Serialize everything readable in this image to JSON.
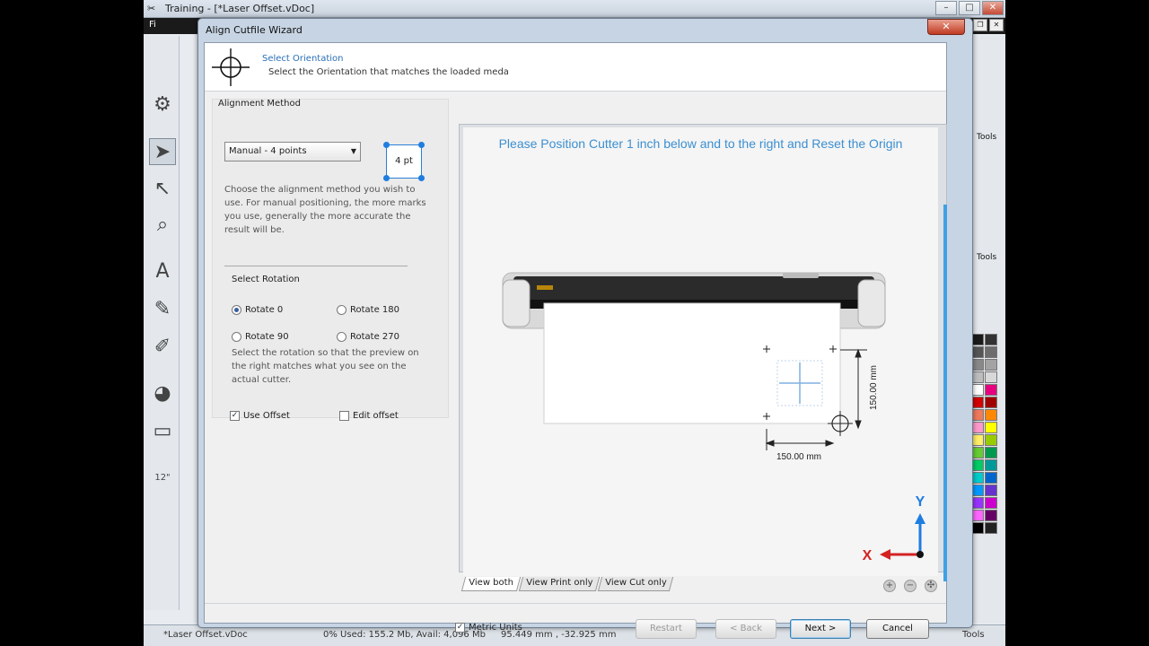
{
  "app": {
    "title": "Training - [*Laser Offset.vDoc]",
    "menu_first": "Fi",
    "right_panel": {
      "tools_label": "Tools",
      "tools_label2": "Tools"
    },
    "status": {
      "doc": "*Laser Offset.vDoc",
      "memory": "0%  Used: 155.2 Mb, Avail: 4,096 Mb",
      "coords": "95.449 mm , -32.925 mm",
      "tools": "Tools"
    }
  },
  "dialog": {
    "title": "Align Cutfile Wizard",
    "close_glyph": "✕",
    "header": {
      "title": "Select Orientation",
      "subtitle": "Select the Orientation that matches the loaded meda"
    },
    "alignment": {
      "label": "Alignment Method",
      "selected": "Manual - 4 points",
      "point_badge": "4 pt",
      "description": "Choose the alignment method you wish to use. For manual positioning, the more marks you use, generally the more accurate the result will be."
    },
    "rotation": {
      "label": "Select Rotation",
      "options": [
        "Rotate 0",
        "Rotate 180",
        "Rotate 90",
        "Rotate 270"
      ],
      "selected": "Rotate 0",
      "description": "Select the rotation so that the preview on the right matches what you see on the actual cutter."
    },
    "use_offset": {
      "label": "Use Offset",
      "checked": true
    },
    "edit_offset": {
      "label": "Edit offset",
      "checked": false
    },
    "preview": {
      "instruction": "Please Position Cutter 1 inch below and to the right and Reset the Origin",
      "dim_vertical": "150.00 mm",
      "dim_horizontal": "150.00 mm",
      "axis_y": "Y",
      "axis_x": "X"
    },
    "view_tabs": [
      "View both",
      "View Print only",
      "View Cut only"
    ],
    "active_tab": "View both",
    "zoom_icons": [
      "zoom-in-icon",
      "zoom-out-icon",
      "zoom-fit-icon"
    ],
    "metric_units": {
      "label": "Metric Units",
      "checked": true
    },
    "buttons": {
      "restart": "Restart",
      "back": "< Back",
      "next": "Next >",
      "cancel": "Cancel"
    }
  },
  "colors": {
    "accent": "#2a6fb6",
    "instruction": "#3b8fd0",
    "axis_y": "#1e7de0",
    "axis_x": "#d32222",
    "palette": [
      "#1a1a1a",
      "#333333",
      "#555555",
      "#6d6d6d",
      "#888888",
      "#a3a3a3",
      "#bdbdbd",
      "#d8d8d8",
      "#ffffff",
      "#e6007e",
      "#d40000",
      "#a00000",
      "#f07a5a",
      "#ff8800",
      "#ff99cc",
      "#ffff00",
      "#ffee66",
      "#99cc00",
      "#66cc33",
      "#00994d",
      "#00cc66",
      "#009999",
      "#00cccc",
      "#0066cc",
      "#0099ff",
      "#6633cc",
      "#9933ff",
      "#cc00cc",
      "#ff66ff",
      "#660066",
      "#000000",
      "#222222"
    ]
  }
}
